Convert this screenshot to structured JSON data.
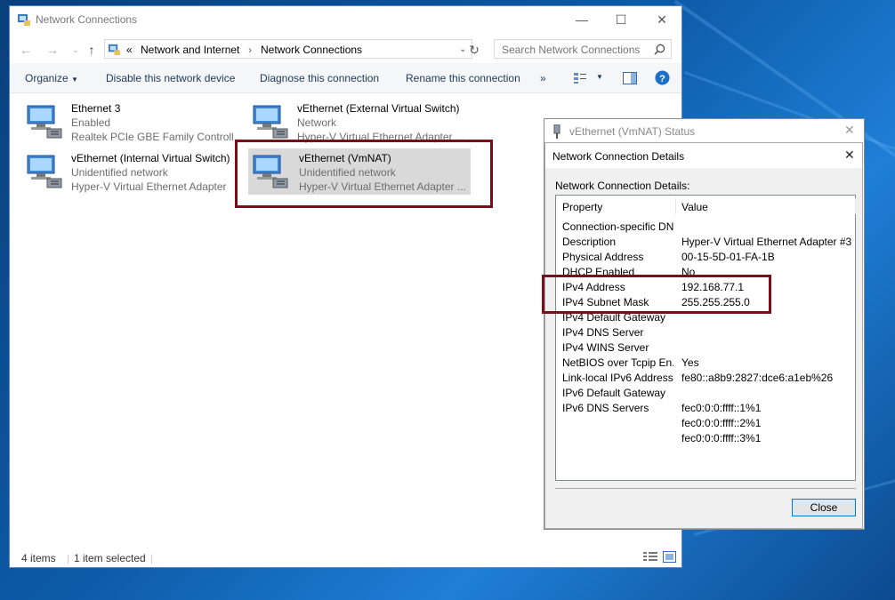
{
  "explorer": {
    "title": "Network Connections",
    "breadcrumb": {
      "chevrons": "«",
      "part1": "Network and Internet",
      "sep": "›",
      "part2": "Network Connections"
    },
    "search_placeholder": "Search Network Connections",
    "toolbar": {
      "organize": "Organize",
      "disable": "Disable this network device",
      "diagnose": "Diagnose this connection",
      "rename": "Rename this connection",
      "more": "»"
    },
    "items": [
      {
        "name": "Ethernet 3",
        "status": "Enabled",
        "adapter": "Realtek PCIe GBE Family Controll..."
      },
      {
        "name": "vEthernet (External Virtual Switch)",
        "status": "Network",
        "adapter": "Hyper-V Virtual Ethernet Adapter ..."
      },
      {
        "name": "vEthernet (Internal Virtual Switch)",
        "status": "Unidentified network",
        "adapter": "Hyper-V Virtual Ethernet Adapter"
      },
      {
        "name": "vEthernet (VmNAT)",
        "status": "Unidentified network",
        "adapter": "Hyper-V Virtual Ethernet Adapter ..."
      }
    ],
    "statusbar": {
      "count": "4 items",
      "selected": "1 item selected"
    }
  },
  "status_dialog": {
    "title": "vEthernet (VmNAT) Status"
  },
  "details_dialog": {
    "title": "Network Connection Details",
    "group_label": "Network Connection Details:",
    "col_property": "Property",
    "col_value": "Value",
    "rows": [
      {
        "k": "Connection-specific DN...",
        "v": ""
      },
      {
        "k": "Description",
        "v": "Hyper-V Virtual Ethernet Adapter #3"
      },
      {
        "k": "Physical Address",
        "v": "00-15-5D-01-FA-1B"
      },
      {
        "k": "DHCP Enabled",
        "v": "No"
      },
      {
        "k": "IPv4 Address",
        "v": "192.168.77.1"
      },
      {
        "k": "IPv4 Subnet Mask",
        "v": "255.255.255.0"
      },
      {
        "k": "IPv4 Default Gateway",
        "v": ""
      },
      {
        "k": "IPv4 DNS Server",
        "v": ""
      },
      {
        "k": "IPv4 WINS Server",
        "v": ""
      },
      {
        "k": "NetBIOS over Tcpip En...",
        "v": "Yes"
      },
      {
        "k": "Link-local IPv6 Address",
        "v": "fe80::a8b9:2827:dce6:a1eb%26"
      },
      {
        "k": "IPv6 Default Gateway",
        "v": ""
      },
      {
        "k": "IPv6 DNS Servers",
        "v": "fec0:0:0:ffff::1%1"
      },
      {
        "k": "",
        "v": "fec0:0:0:ffff::2%1"
      },
      {
        "k": "",
        "v": "fec0:0:0:ffff::3%1"
      }
    ],
    "close_label": "Close"
  },
  "colors": {
    "highlight": "#7a0f1c",
    "link": "#1e395b"
  }
}
